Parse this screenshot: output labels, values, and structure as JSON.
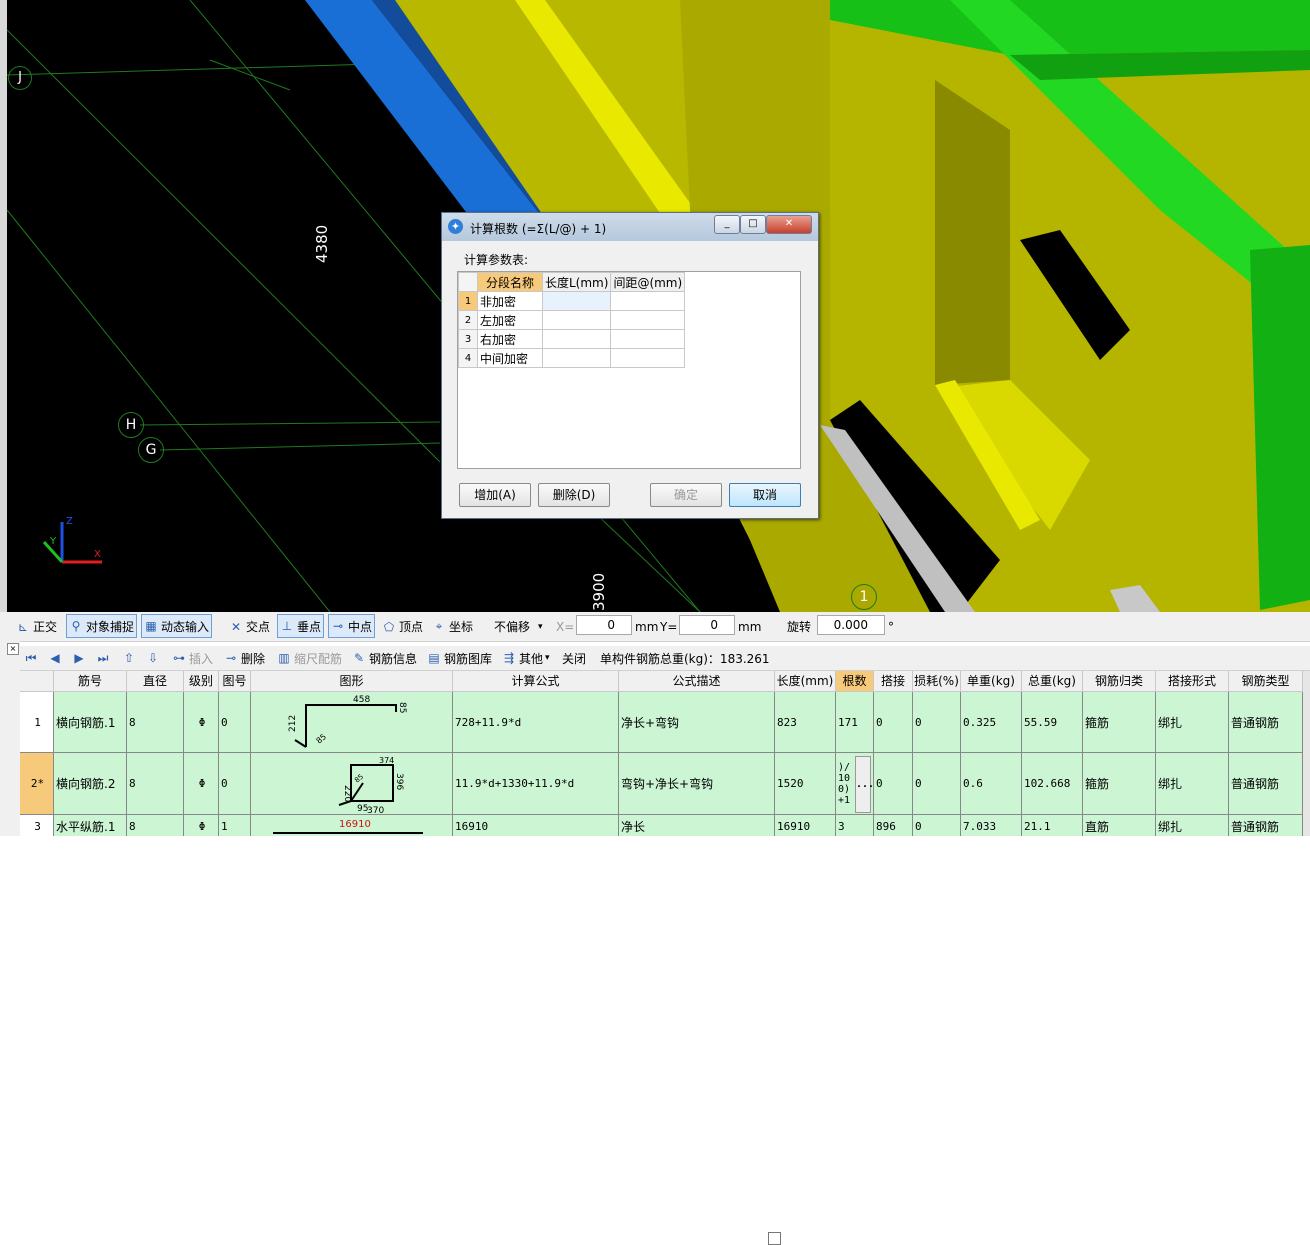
{
  "viewport": {
    "axis_labels": [
      "J",
      "H",
      "G",
      "1"
    ],
    "dimensions": [
      "4380",
      "3900"
    ],
    "gizmo": {
      "x": "X",
      "y": "Y",
      "z": "Z"
    }
  },
  "dialog": {
    "title": "计算根数 (=Σ(L/@) + 1)",
    "params_label": "计算参数表:",
    "columns": [
      "分段名称",
      "长度L(mm)",
      "间距@(mm)"
    ],
    "rows": [
      {
        "no": "1",
        "name": "非加密",
        "length": "",
        "spacing": ""
      },
      {
        "no": "2",
        "name": "左加密",
        "length": "",
        "spacing": ""
      },
      {
        "no": "3",
        "name": "右加密",
        "length": "",
        "spacing": ""
      },
      {
        "no": "4",
        "name": "中间加密",
        "length": "",
        "spacing": ""
      }
    ],
    "buttons": {
      "add": "增加(A)",
      "delete": "删除(D)",
      "ok": "确定",
      "cancel": "取消"
    },
    "window_buttons": {
      "min": "_",
      "max": "□",
      "close": "✕"
    }
  },
  "snap_toolbar": {
    "ortho": "正交",
    "snap": "对象捕捉",
    "dyn_input": "动态输入",
    "intersection": "交点",
    "perpendicular": "垂点",
    "midpoint": "中点",
    "vertex": "顶点",
    "coordinate": "坐标",
    "offset_select": "不偏移",
    "x_label": "X=",
    "x_value": "0",
    "x_unit": "mm",
    "y_label": "Y=",
    "y_value": "0",
    "y_unit": "mm",
    "rotate_label": "旋转",
    "rotate_value": "0.000",
    "degree": "°"
  },
  "rebar_toolbar": {
    "insert": "插入",
    "delete": "删除",
    "scale": "缩尺配筋",
    "info": "钢筋信息",
    "library": "钢筋图库",
    "other": "其他",
    "close": "关闭",
    "total_weight": "单构件钢筋总重(kg)：183.261"
  },
  "rebar_table": {
    "headers": [
      "筋号",
      "直径(mm)",
      "级别",
      "图号",
      "图形",
      "计算公式",
      "公式描述",
      "长度(mm)",
      "根数",
      "搭接",
      "损耗(%)",
      "单重(kg)",
      "总重(kg)",
      "钢筋归类",
      "搭接形式",
      "钢筋类型"
    ],
    "rows": [
      {
        "no": "1",
        "name": "横向钢筋.1",
        "dia": "8",
        "grade": "Φ",
        "fig": "0",
        "formula": "728+11.9*d",
        "desc": "净长+弯钩",
        "length": "823",
        "count": "171",
        "lap": "0",
        "loss": "0",
        "unit_w": "0.325",
        "total_w": "55.59",
        "category": "箍筋",
        "lap_type": "绑扎",
        "type": "普通钢筋",
        "shape": {
          "a": "458",
          "b": "212",
          "c": "85",
          "d": "85"
        }
      },
      {
        "no": "2*",
        "name": "横向钢筋.2",
        "dia": "8",
        "grade": "Φ",
        "fig": "0",
        "formula": "11.9*d+1330+11.9*d",
        "desc": "弯钩+净长+弯钩",
        "length": "1520",
        "count": ")/ 10 0) +1",
        "lap": "0",
        "loss": "0",
        "unit_w": "0.6",
        "total_w": "102.668",
        "category": "箍筋",
        "lap_type": "绑扎",
        "type": "普通钢筋",
        "shape": {
          "a": "220",
          "b": "374",
          "c": "396",
          "d": "95",
          "e": "370",
          "f": "85"
        }
      },
      {
        "no": "3",
        "name": "水平纵筋.1",
        "dia": "8",
        "grade": "Φ",
        "fig": "1",
        "formula": "16910",
        "desc": "净长",
        "length": "16910",
        "count": "3",
        "lap": "896",
        "loss": "0",
        "unit_w": "7.033",
        "total_w": "21.1",
        "category": "直筋",
        "lap_type": "绑扎",
        "type": "普通钢筋",
        "shape": {
          "a": "16910"
        }
      }
    ],
    "ellipsis": "..."
  }
}
